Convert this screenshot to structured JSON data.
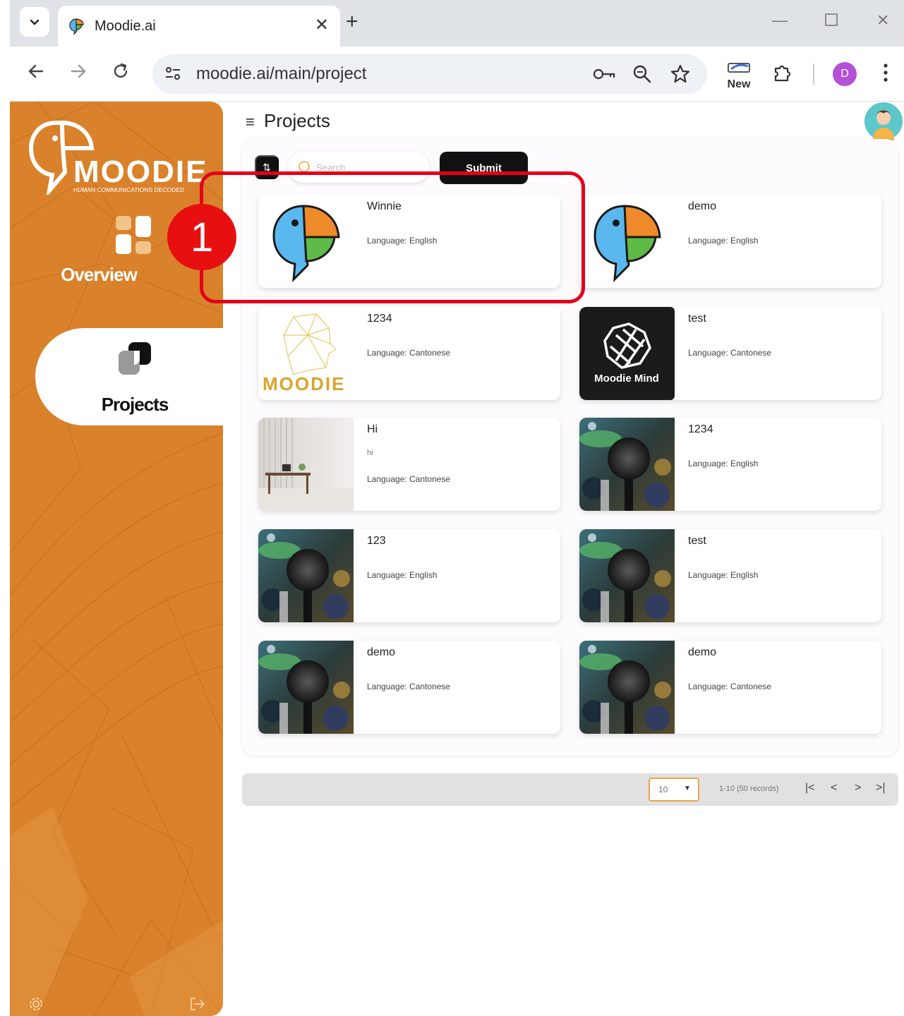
{
  "browser": {
    "tab_title": "Moodie.ai",
    "url": "moodie.ai/main/project",
    "new_badge_label": "New",
    "profile_initial": "D"
  },
  "sidebar": {
    "logo_text": "MOODIE",
    "logo_tagline": "HUMAN COMMUNICATIONS DECODED",
    "items": [
      {
        "label": "Overview",
        "active": false
      },
      {
        "label": "Projects",
        "active": true
      }
    ]
  },
  "main": {
    "title": "Projects",
    "search_placeholder": "Search",
    "submit_label": "Submit"
  },
  "projects": [
    {
      "title": "Winnie",
      "desc": "",
      "language": "Language: English",
      "thumb": "parrot"
    },
    {
      "title": "demo",
      "desc": "",
      "language": "Language: English",
      "thumb": "parrot"
    },
    {
      "title": "1234",
      "desc": "",
      "language": "Language: Cantonese",
      "thumb": "moodie-head"
    },
    {
      "title": "test",
      "desc": "",
      "language": "Language: Cantonese",
      "thumb": "moodie-mind"
    },
    {
      "title": "Hi",
      "desc": "hi",
      "language": "Language: Cantonese",
      "thumb": "room"
    },
    {
      "title": "1234",
      "desc": "",
      "language": "Language: English",
      "thumb": "microphone"
    },
    {
      "title": "123",
      "desc": "",
      "language": "Language: English",
      "thumb": "microphone"
    },
    {
      "title": "test",
      "desc": "",
      "language": "Language: English",
      "thumb": "microphone"
    },
    {
      "title": "demo",
      "desc": "",
      "language": "Language: Cantonese",
      "thumb": "microphone"
    },
    {
      "title": "demo",
      "desc": "",
      "language": "Language: Cantonese",
      "thumb": "microphone"
    }
  ],
  "thumb_text": {
    "moodie_mind": "Moodie Mind",
    "moodie_head_logo": "MOODIE"
  },
  "pagination": {
    "page_size": "10",
    "info": "1-10 (50 records)"
  },
  "annotation": {
    "number": "1"
  },
  "colors": {
    "sidebar": "#d9822b",
    "accent": "#e9a748",
    "annotation": "#e4001b"
  }
}
